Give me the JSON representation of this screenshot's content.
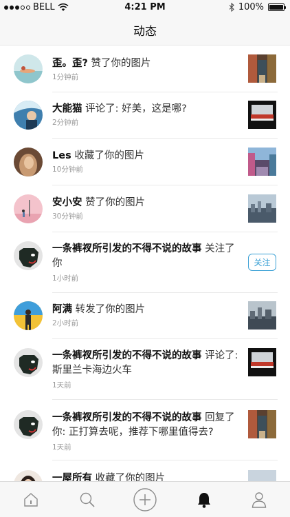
{
  "status_bar": {
    "carrier": "BELL",
    "time": "4:21 PM",
    "battery": "100%"
  },
  "nav": {
    "title": "动态"
  },
  "feed": [
    {
      "name": "歪。歪?",
      "action": " 赞了你的图片",
      "time": "1分钟前",
      "right": "thumb"
    },
    {
      "name": "大能猫",
      "action": " 评论了: 好美，这是哪?",
      "time": "2分钟前",
      "right": "thumb"
    },
    {
      "name": "Les",
      "action": " 收藏了你的图片",
      "time": "10分钟前",
      "right": "thumb"
    },
    {
      "name": "安小安",
      "action": " 赞了你的图片",
      "time": "30分钟前",
      "right": "thumb"
    },
    {
      "name": "一条裤衩所引发的不得不说的故事",
      "action": " 关注了你",
      "time": "1小时前",
      "right": "follow",
      "follow_label": "关注"
    },
    {
      "name": "阿满",
      "action": " 转发了你的图片",
      "time": "2小时前",
      "right": "thumb"
    },
    {
      "name": "一条裤衩所引发的不得不说的故事",
      "action": " 评论了: 斯里兰卡海边火车",
      "time": "1天前",
      "right": "thumb"
    },
    {
      "name": "一条裤衩所引发的不得不说的故事",
      "action": " 回复了你: 正打算去呢，推荐下哪里值得去?",
      "time": "1天前",
      "right": "thumb"
    },
    {
      "name": "一屋所有",
      "action": " 收藏了你的图片",
      "time": "",
      "right": "thumb"
    }
  ],
  "tab_bar": {
    "items": [
      "home-icon",
      "search-icon",
      "add-icon",
      "bell-icon",
      "profile-icon"
    ],
    "active": "bell-icon"
  },
  "colors": {
    "accent": "#3aa0d5",
    "background": "#ffffff",
    "bar": "#f7f7f7",
    "divider": "#e9e9e9"
  }
}
